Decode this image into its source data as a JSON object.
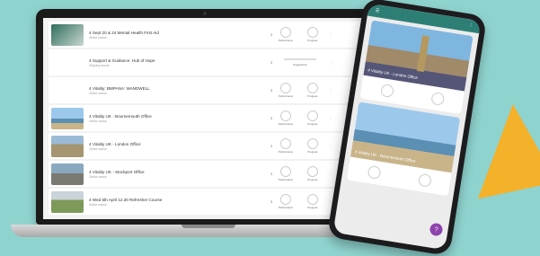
{
  "colors": {
    "background": "#8fd3cf",
    "accent": "#f4b12a",
    "phone_header": "#2d7f76",
    "fab": "#8e44ad"
  },
  "courses": [
    {
      "title": "4 Sept 20 & 24 Mental Health First Aid",
      "sub": "Online course",
      "count": "3",
      "progress": "",
      "thumb": "mhfa"
    },
    {
      "title": "4 Support & Guidance: Hub of Hope",
      "sub": "Ongoing course",
      "count": "3",
      "progress": "",
      "thumb": "hope"
    },
    {
      "title": "4 Vitality: BMPANA: WANDWELL",
      "sub": "Online course",
      "count": "3",
      "progress": "",
      "thumb": "vitality"
    },
    {
      "title": "4 Vitality UK - Bournemouth Office",
      "sub": "Online course",
      "count": "3",
      "progress": "",
      "thumb": "beach"
    },
    {
      "title": "4 Vitality UK - London Office",
      "sub": "Online course",
      "count": "3",
      "progress": "",
      "thumb": "london"
    },
    {
      "title": "4 Vitality UK - Stockport Office",
      "sub": "Online course",
      "count": "3",
      "progress": "",
      "thumb": "stockport"
    },
    {
      "title": "4 Wed 5th April 12.30 Refresher Course",
      "sub": "Online course",
      "count": "3",
      "progress": "",
      "thumb": "field"
    }
  ],
  "labels": {
    "performance": "Performance",
    "progress": "Progress",
    "suggestions": "Suggestions"
  },
  "phone": {
    "cards": [
      {
        "caption": "4 Vitality UK - London Office"
      },
      {
        "caption": "4 Vitality UK - Bournemouth Office"
      }
    ],
    "fab_label": "?"
  }
}
